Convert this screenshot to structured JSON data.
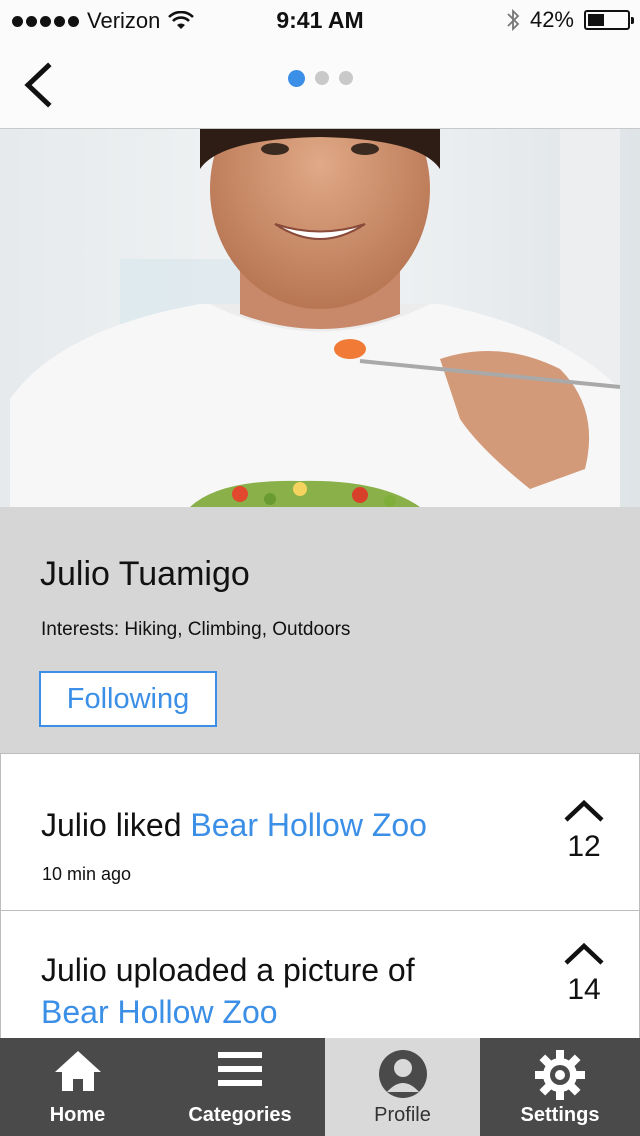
{
  "status_bar": {
    "carrier": "Verizon",
    "time": "9:41 AM",
    "battery": "42%",
    "battery_level": 0.42
  },
  "nav": {
    "page_indicator": {
      "count": 3,
      "active_index": 0
    }
  },
  "profile": {
    "name": "Julio Tuamigo",
    "interests": "Interests: Hiking, Climbing, Outdoors",
    "follow_label": "Following"
  },
  "feed": [
    {
      "actor": "Julio",
      "action": " liked ",
      "target": "Bear Hollow Zoo",
      "time": "10 min ago",
      "votes": "12"
    },
    {
      "actor": "Julio",
      "action": " uploaded a picture of ",
      "target": "Bear Hollow Zoo",
      "votes": "14"
    }
  ],
  "tabs": [
    {
      "label": "Home",
      "icon": "home-icon"
    },
    {
      "label": "Categories",
      "icon": "menu-icon"
    },
    {
      "label": "Profile",
      "icon": "user-icon",
      "active": true
    },
    {
      "label": "Settings",
      "icon": "gear-icon"
    }
  ],
  "colors": {
    "accent": "#3b8fe6",
    "tab_bg": "#4a4a4a",
    "tab_active_bg": "#d9d9d9",
    "panel_bg": "#d6d6d6"
  }
}
